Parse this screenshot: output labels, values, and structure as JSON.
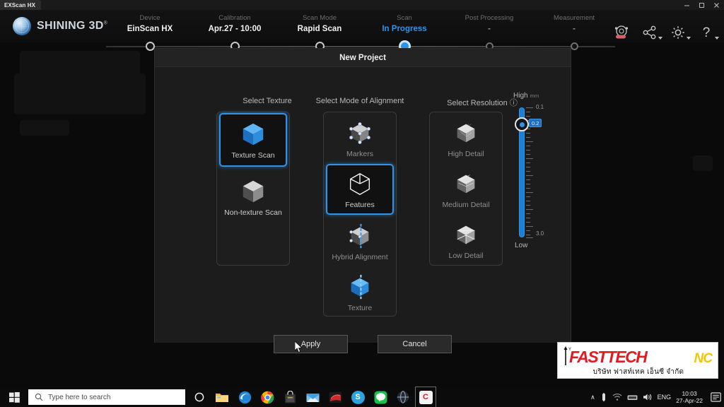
{
  "window": {
    "tab_title": "EXScan HX",
    "controls": {
      "minimize": "minimize-icon",
      "maximize": "maximize-icon",
      "close": "close-icon"
    }
  },
  "header": {
    "brand": "SHINING 3D",
    "brand_mark": "®",
    "steps": [
      {
        "label": "Device",
        "value": "EinScan HX",
        "state": "done"
      },
      {
        "label": "Calibration",
        "value": "Apr.27 - 10:00",
        "state": "done"
      },
      {
        "label": "Scan Mode",
        "value": "Rapid Scan",
        "state": "done"
      },
      {
        "label": "Scan",
        "value": "In Progress",
        "state": "active"
      },
      {
        "label": "Post Processing",
        "value": "-",
        "state": "pending"
      },
      {
        "label": "Measurement",
        "value": "-",
        "state": "pending"
      }
    ],
    "icons": [
      {
        "name": "scan-settings-icon",
        "caret": false
      },
      {
        "name": "share-icon",
        "caret": true
      },
      {
        "name": "gear-icon",
        "caret": true
      },
      {
        "name": "help-icon",
        "caret": true
      }
    ]
  },
  "dialog": {
    "title": "New Project",
    "columns": {
      "texture": {
        "heading": "Select Texture",
        "options": [
          {
            "label": "Texture Scan",
            "selected": true,
            "icon": "blue-cube-icon"
          },
          {
            "label": "Non-texture Scan",
            "selected": false,
            "icon": "gray-cube-icon"
          }
        ]
      },
      "alignment": {
        "heading": "Select Mode of Alignment",
        "options": [
          {
            "label": "Markers",
            "selected": false,
            "icon": "marker-cube-icon"
          },
          {
            "label": "Features",
            "selected": true,
            "icon": "wire-cube-icon"
          },
          {
            "label": "Hybrid Alignment",
            "selected": false,
            "icon": "hybrid-cube-icon"
          },
          {
            "label": "Texture",
            "selected": false,
            "icon": "blue-texture-cube-icon"
          }
        ]
      },
      "resolution": {
        "heading": "Select Resolution",
        "info_glyph": "ⓘ",
        "options": [
          {
            "label": "High Detail",
            "selected": false,
            "icon": "dense-cube-icon"
          },
          {
            "label": "Medium Detail",
            "selected": false,
            "icon": "medium-cube-icon"
          },
          {
            "label": "Low Detail",
            "selected": false,
            "icon": "sparse-cube-icon"
          }
        ],
        "slider": {
          "top_label": "High",
          "unit": "mm",
          "bottom_label": "Low",
          "max_value": "0.1",
          "min_value": "3.0",
          "current_value": "0.2"
        }
      }
    },
    "buttons": {
      "apply": "Apply",
      "cancel": "Cancel"
    }
  },
  "watermark": {
    "text_main": "FASTTECH",
    "text_suffix": "NC",
    "reg": "®",
    "axis_label": "Y",
    "thai_line": "บริษัท  ฟาสท์เทค  เอ็นซี  จำกัด"
  },
  "taskbar": {
    "start_icon": "windows-start-icon",
    "search_placeholder": "Type here to search",
    "search_icon": "search-icon",
    "pinned": [
      {
        "name": "cortana-icon",
        "glyph": "○",
        "color": "#0b0b0b",
        "fg": "#e9e9e9"
      },
      {
        "name": "file-explorer-icon",
        "glyph": "",
        "color": "#f7c04a",
        "fg": "#7a5c10"
      },
      {
        "name": "edge-icon",
        "glyph": "",
        "color": "#2a7fd4",
        "fg": "#ffffff"
      },
      {
        "name": "chrome-icon",
        "glyph": "",
        "color": "#e8453c",
        "fg": "#ffffff"
      },
      {
        "name": "store-icon",
        "glyph": "",
        "color": "#2b2b2b",
        "fg": "#d8d8d8"
      },
      {
        "name": "mail-icon",
        "glyph": "",
        "color": "#3aa0e8",
        "fg": "#ffffff"
      },
      {
        "name": "media-icon",
        "glyph": "",
        "color": "#1a1a1a",
        "fg": "#d93b3b"
      },
      {
        "name": "skype-icon",
        "glyph": "S",
        "color": "#2aa3e0",
        "fg": "#ffffff"
      },
      {
        "name": "line-icon",
        "glyph": "",
        "color": "#17c24a",
        "fg": "#ffffff"
      },
      {
        "name": "browser-icon",
        "glyph": "",
        "color": "#20242b",
        "fg": "#cfd6dd"
      },
      {
        "name": "exscan-app-icon",
        "glyph": "C",
        "color": "#f2f2f2",
        "fg": "#d31f26"
      }
    ],
    "tray": {
      "chevron": "∧",
      "items": [
        "pen-icon",
        "wifi-icon",
        "network-icon",
        "volume-icon"
      ],
      "language": "ENG",
      "time": "10:03",
      "date": "27-Apr-22",
      "action_center": "notification-icon"
    }
  }
}
